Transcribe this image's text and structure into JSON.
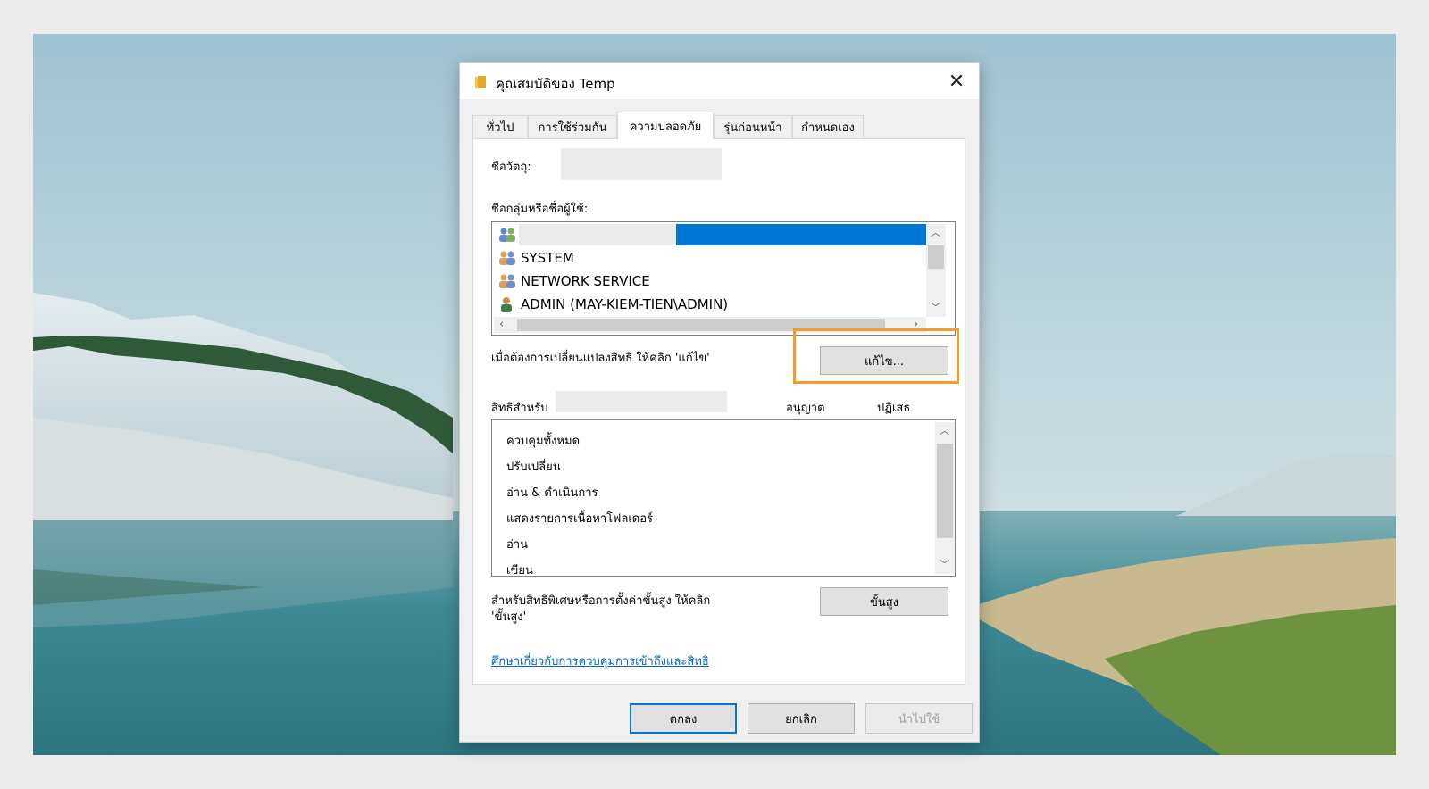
{
  "dialog": {
    "title": "คุณสมบัติของ Temp",
    "close_symbol": "✕",
    "tabs": [
      {
        "label": "ทั่วไป"
      },
      {
        "label": "การใช้ร่วมกัน"
      },
      {
        "label": "ความปลอดภัย"
      },
      {
        "label": "รุ่นก่อนหน้า"
      },
      {
        "label": "กำหนดเอง"
      }
    ],
    "active_tab": "ความปลอดภัย"
  },
  "security": {
    "object_name_label": "ชื่อวัตถุ:",
    "group_label": "ชื่อกลุ่มหรือชื่อผู้ใช้:",
    "users": [
      {
        "name": "",
        "icon": "group-users-icon",
        "selected": true
      },
      {
        "name": "SYSTEM",
        "icon": "group-users-icon"
      },
      {
        "name": "NETWORK SERVICE",
        "icon": "group-users-icon"
      },
      {
        "name": "ADMIN (MAY-KIEM-TIEN\\ADMIN)",
        "icon": "single-user-icon"
      }
    ],
    "edit_hint": "เมื่อต้องการเปลี่ยนแปลงสิทธิ ให้คลิก 'แก้ไข'",
    "edit_button": "แก้ไข...",
    "permissions_for_label": "สิทธิสำหรับ",
    "allow_header": "อนุญาต",
    "deny_header": "ปฏิเสธ",
    "permissions": [
      "ควบคุมทั้งหมด",
      "ปรับเปลี่ยน",
      "อ่าน & ดำเนินการ",
      "แสดงรายการเนื้อหาโฟลเดอร์",
      "อ่าน",
      "เขียน"
    ],
    "advanced_hint_line1": "สำหรับสิทธิพิเศษหรือการตั้งค่าขั้นสูง ให้คลิก",
    "advanced_hint_line2": "'ขั้นสูง'",
    "advanced_button": "ขั้นสูง",
    "learn_link": "ศึกษาเกี่ยวกับการควบคุมการเข้าถึงและสิทธิ"
  },
  "footer": {
    "ok": "ตกลง",
    "cancel": "ยกเลิก",
    "apply": "นำไปใช้"
  },
  "colors": {
    "selection": "#0078d7",
    "highlight": "#f39b2d",
    "link": "#0066cc"
  }
}
